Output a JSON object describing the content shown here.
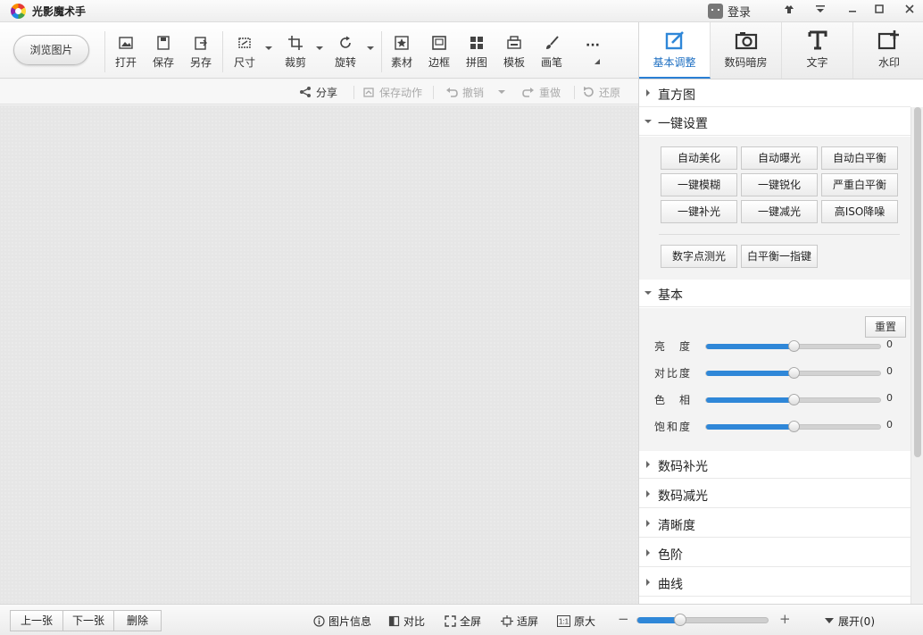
{
  "app": {
    "title": "光影魔术手",
    "login": "登录"
  },
  "window_controls": {
    "skin": "⇡",
    "menu": "≡",
    "minimize": "─",
    "maximize": "□",
    "close": "✕"
  },
  "toolbar": {
    "browse": "浏览图片",
    "tools": [
      {
        "label": "打开",
        "icon": "open-icon"
      },
      {
        "label": "保存",
        "icon": "save-icon"
      },
      {
        "label": "另存",
        "icon": "save-as-icon"
      },
      {
        "label": "尺寸",
        "icon": "resize-icon"
      },
      {
        "label": "裁剪",
        "icon": "crop-icon"
      },
      {
        "label": "旋转",
        "icon": "rotate-icon"
      },
      {
        "label": "素材",
        "icon": "material-icon"
      },
      {
        "label": "边框",
        "icon": "border-icon"
      },
      {
        "label": "拼图",
        "icon": "collage-icon"
      },
      {
        "label": "模板",
        "icon": "template-icon"
      },
      {
        "label": "画笔",
        "icon": "brush-icon"
      },
      {
        "label": "···",
        "icon": "more-icon"
      }
    ]
  },
  "subbar": {
    "share": "分享",
    "save_action": "保存动作",
    "undo": "撤销",
    "redo": "重做",
    "restore": "还原"
  },
  "right_tabs": [
    {
      "label": "基本调整",
      "icon": "basic-adjust-icon",
      "active": true
    },
    {
      "label": "数码暗房",
      "icon": "camera-icon",
      "active": false
    },
    {
      "label": "文字",
      "icon": "text-icon",
      "active": false
    },
    {
      "label": "水印",
      "icon": "watermark-icon",
      "active": false
    }
  ],
  "panel": {
    "histogram": "直方图",
    "one_click": {
      "title": "一键设置",
      "buttons": [
        [
          "自动美化",
          "自动曝光",
          "自动白平衡"
        ],
        [
          "一键模糊",
          "一键锐化",
          "严重白平衡"
        ],
        [
          "一键补光",
          "一键减光",
          "高ISO降噪"
        ]
      ],
      "extra_buttons": [
        "数字点测光",
        "白平衡一指键"
      ]
    },
    "basic": {
      "title": "基本",
      "reset": "重置",
      "sliders": [
        {
          "label": "亮　度",
          "value": "0",
          "level": 0.5
        },
        {
          "label": "对比度",
          "value": "0",
          "level": 0.5
        },
        {
          "label": "色　相",
          "value": "0",
          "level": 0.5
        },
        {
          "label": "饱和度",
          "value": "0",
          "level": 0.5
        }
      ]
    },
    "sections": [
      "数码补光",
      "数码减光",
      "清晰度",
      "色阶",
      "曲线"
    ]
  },
  "bottom": {
    "prev": "上一张",
    "next": "下一张",
    "delete": "删除",
    "info": "图片信息",
    "compare": "对比",
    "fullscreen": "全屏",
    "fit": "适屏",
    "original": "原大",
    "zoom_minus": "−",
    "zoom_plus": "+",
    "zoom_level": 0.33,
    "expand": "展开(0)"
  },
  "colors": {
    "accent": "#2f87d8",
    "active_tab_text": "#1e6fc2"
  }
}
